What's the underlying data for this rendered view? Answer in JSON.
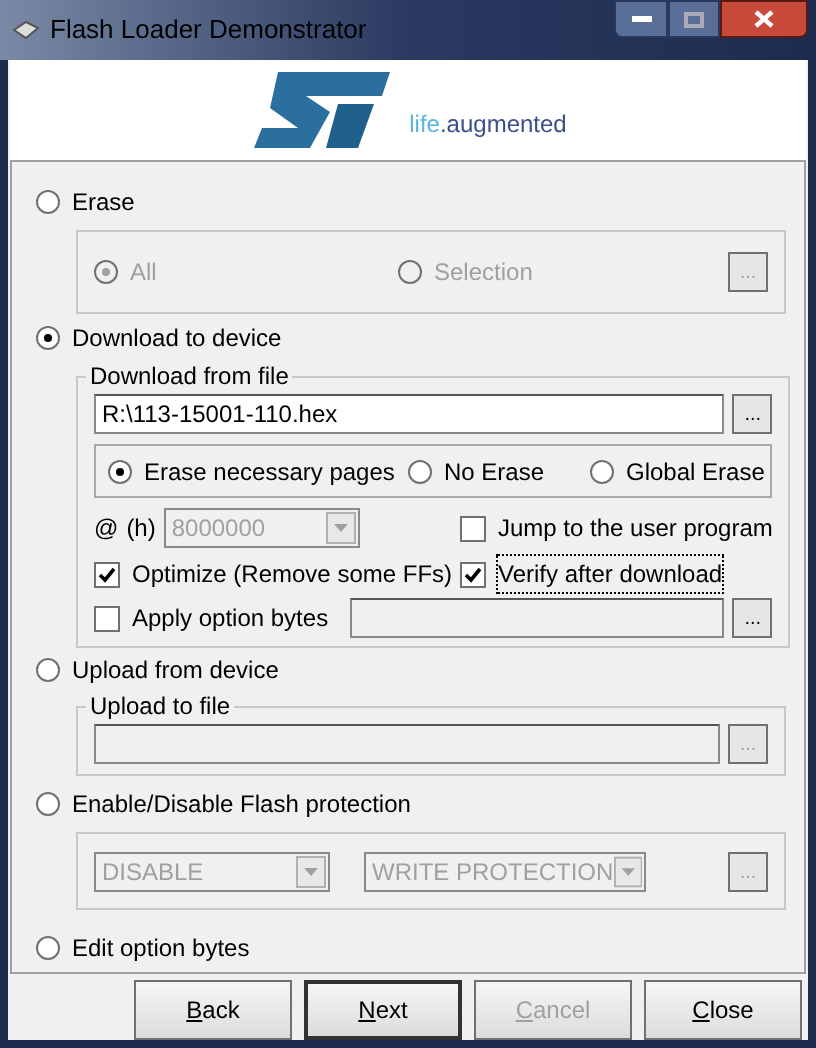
{
  "window": {
    "title": "Flash Loader Demonstrator"
  },
  "logo": {
    "tagline": [
      {
        "text": "life",
        "color": "#5ab4e0"
      },
      {
        "text": ".augmented",
        "color": "#3c4f8c"
      }
    ]
  },
  "erase": {
    "label": "Erase",
    "selected": false,
    "disabled": true,
    "options": [
      {
        "label": "All",
        "selected": true
      },
      {
        "label": "Selection",
        "selected": false
      }
    ],
    "browse": "..."
  },
  "download": {
    "label": "Download to device",
    "selected": true,
    "group_title": "Download from file",
    "file": "R:\\113-15001-110.hex",
    "browse": "...",
    "erase_modes": [
      {
        "label": "Erase necessary pages",
        "selected": true
      },
      {
        "label": "No Erase",
        "selected": false
      },
      {
        "label": "Global Erase",
        "selected": false
      }
    ],
    "address": {
      "prefix": "@",
      "unit": "(h)",
      "value": "8000000",
      "disabled": true
    },
    "jump": {
      "label": "Jump to the user program",
      "checked": false,
      "focused": false
    },
    "optimize": {
      "label": "Optimize (Remove some FFs)",
      "checked": true,
      "focused": false
    },
    "verify": {
      "label": "Verify after download",
      "checked": true,
      "focused": true
    },
    "apply_option_bytes": {
      "label": "Apply option bytes",
      "checked": false,
      "focused": false,
      "browse": "..."
    }
  },
  "upload": {
    "label": "Upload from device",
    "selected": false,
    "disabled": true,
    "group_title": "Upload to file",
    "browse": "..."
  },
  "protection": {
    "label": "Enable/Disable Flash protection",
    "selected": false,
    "disabled": true,
    "action": "DISABLE",
    "type": "WRITE PROTECTION",
    "browse": "..."
  },
  "edit_option_bytes": {
    "label": "Edit option bytes",
    "selected": false
  },
  "buttons": [
    {
      "label": "Back",
      "disabled": false,
      "default": false
    },
    {
      "label": "Next",
      "disabled": false,
      "default": true
    },
    {
      "label": "Cancel",
      "disabled": true,
      "default": false
    },
    {
      "label": "Close",
      "disabled": false,
      "default": false
    }
  ]
}
